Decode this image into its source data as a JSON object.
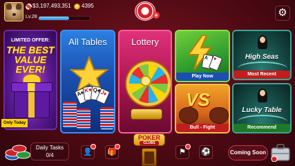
{
  "profile": {
    "chips": "$3,197,493,351",
    "gold": "4395",
    "level": "Lv.28",
    "xp_fraction": 0.6
  },
  "cards": {
    "offer": {
      "line1": "LIMITED OFFER:",
      "line2": "THE BEST",
      "line3": "VALUE EVER!",
      "ribbon": "Only Today"
    },
    "all_tables": {
      "title": "All Tables"
    },
    "lottery": {
      "title": "Lottery"
    },
    "play_now": {
      "label": "Play Now"
    },
    "bull_fight": {
      "vs": "VS",
      "label": "Bull - Fight"
    },
    "high_seas": {
      "title": "High Seas",
      "label": "Most Recent"
    },
    "lucky_table": {
      "title": "Lucky Table",
      "label": "Recommend"
    }
  },
  "bottom": {
    "tasks_label": "Daily Tasks",
    "tasks_progress": "0/4",
    "club_line1": "POKER",
    "club_line2": "CLUBS",
    "coming_soon": "Coming Soon"
  },
  "playing_cards": [
    "A♠",
    "K♥",
    "Q♣",
    "J♦"
  ],
  "icons": [
    "chip-icon",
    "gold-coin-icon",
    "settings-gear-icon",
    "friends-icon",
    "gift-icon",
    "flag-icon",
    "soccer-ball-icon",
    "briefcase-icon"
  ]
}
